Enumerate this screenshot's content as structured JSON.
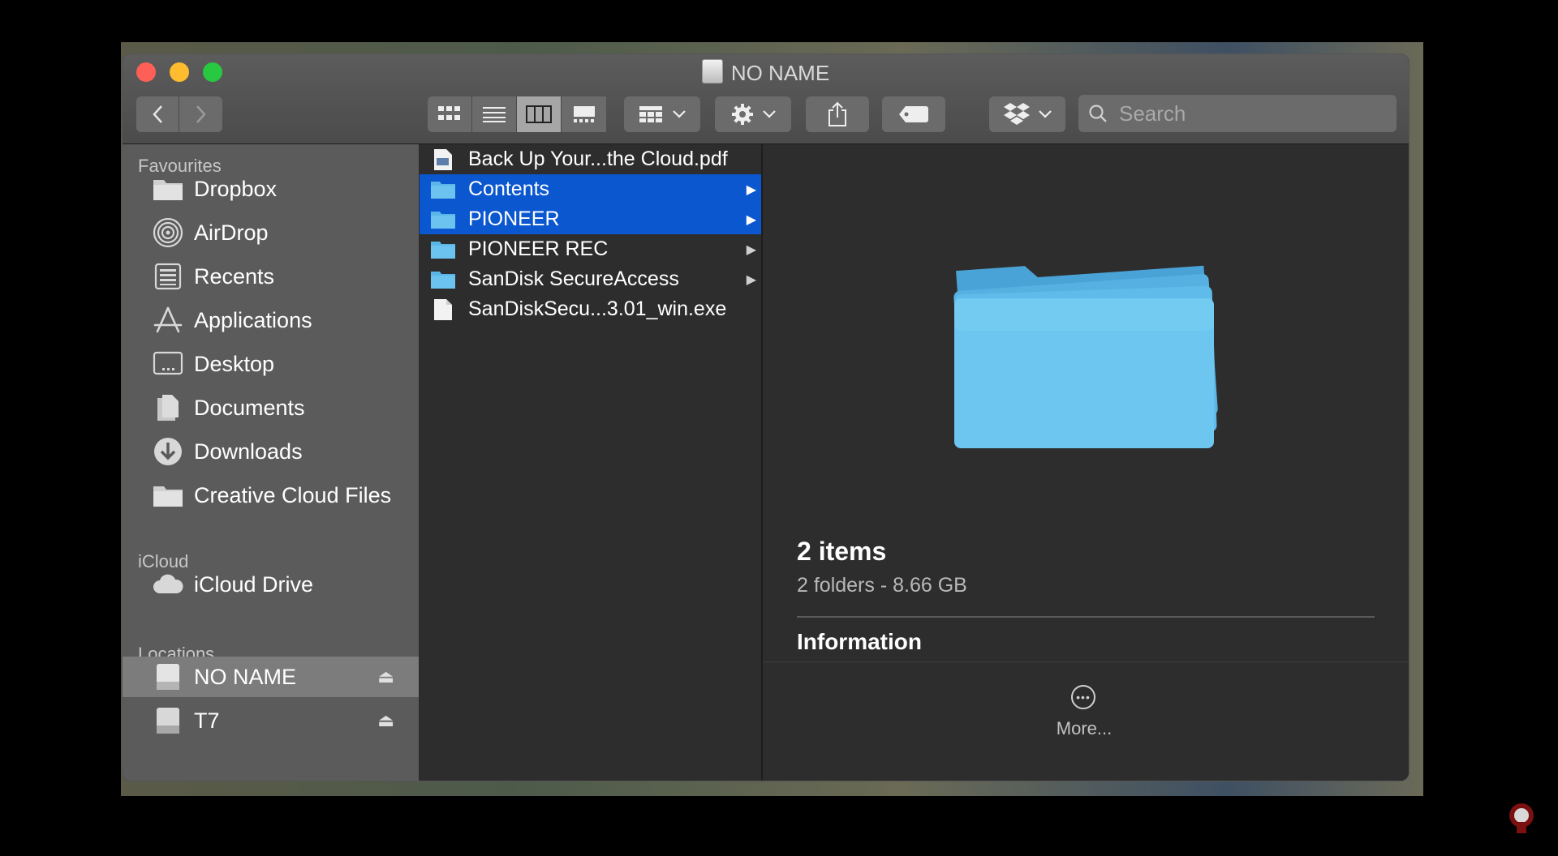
{
  "window": {
    "title": "NO NAME"
  },
  "search": {
    "placeholder": "Search"
  },
  "sidebar": {
    "favourites_header": "Favourites",
    "favourites": [
      {
        "label": "Dropbox",
        "icon": "folder-icon"
      },
      {
        "label": "AirDrop",
        "icon": "airdrop-icon"
      },
      {
        "label": "Recents",
        "icon": "recents-icon"
      },
      {
        "label": "Applications",
        "icon": "applications-icon"
      },
      {
        "label": "Desktop",
        "icon": "desktop-icon"
      },
      {
        "label": "Documents",
        "icon": "documents-icon"
      },
      {
        "label": "Downloads",
        "icon": "downloads-icon"
      },
      {
        "label": "Creative Cloud Files",
        "icon": "folder-icon"
      }
    ],
    "icloud_header": "iCloud",
    "icloud": [
      {
        "label": "iCloud Drive",
        "icon": "cloud-icon"
      }
    ],
    "locations_header": "Locations",
    "locations": [
      {
        "label": "NO NAME",
        "icon": "drive-icon",
        "selected": true
      },
      {
        "label": "T7",
        "icon": "drive-icon",
        "selected": false
      }
    ]
  },
  "files": [
    {
      "name": "Back Up Your...the Cloud.pdf",
      "type": "pdf",
      "selected": false,
      "has_children": false
    },
    {
      "name": "Contents",
      "type": "folder",
      "selected": true,
      "has_children": true
    },
    {
      "name": "PIONEER",
      "type": "folder",
      "selected": true,
      "has_children": true
    },
    {
      "name": "PIONEER REC",
      "type": "folder",
      "selected": false,
      "has_children": true
    },
    {
      "name": "SanDisk SecureAccess",
      "type": "folder",
      "selected": false,
      "has_children": true
    },
    {
      "name": "SanDiskSecu...3.01_win.exe",
      "type": "file",
      "selected": false,
      "has_children": false
    }
  ],
  "preview": {
    "title": "2 items",
    "subtitle": "2 folders - 8.66 GB",
    "info_header": "Information",
    "more_label": "More..."
  },
  "colors": {
    "selection": "#0b57d0",
    "folder_blue": "#5bb6e8",
    "sidebar_bg": "#5b5b5b",
    "window_bg": "#2d2d2d"
  }
}
